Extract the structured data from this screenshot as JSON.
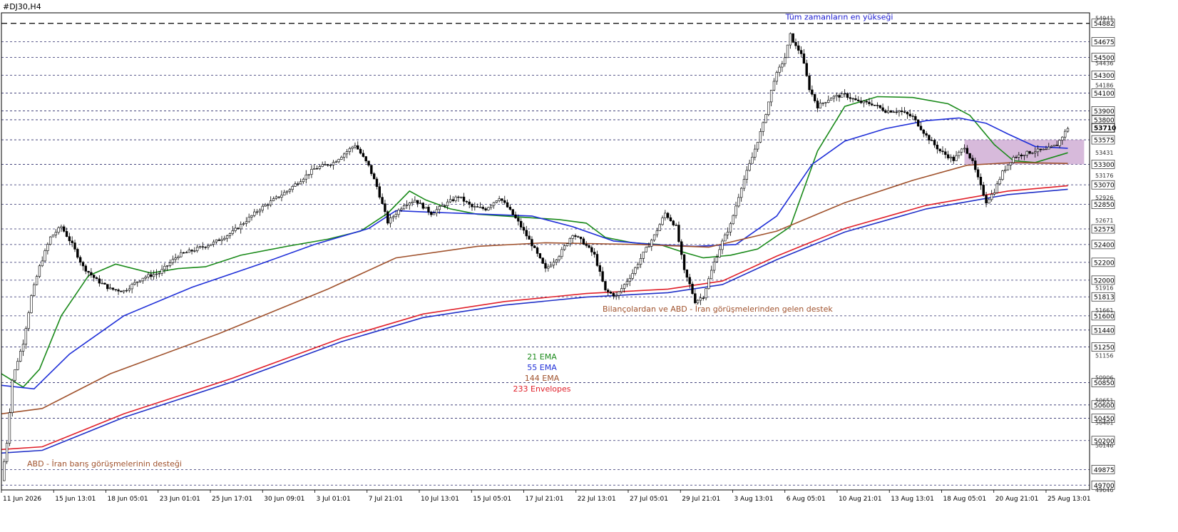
{
  "window": {
    "symbol_title": "#DJ30,H4"
  },
  "colors": {
    "background": "#ffffff",
    "candle": "#000000",
    "ema21": "#1a8a1a",
    "ema55": "#1f2fd8",
    "ema144": "#a0522d",
    "envelope_upper": "#e0202a",
    "envelope_lower": "#2030c8",
    "level_line": "#2a2a6a",
    "ath_line": "#000000",
    "zone_fill": "#c9a3cf",
    "ath_label": "#1a1ad0",
    "note_label": "#a0522d"
  },
  "chart_data": {
    "type": "candlestick",
    "symbol": "#DJ30",
    "timeframe": "H4",
    "price_range": [
      49646,
      55000
    ],
    "x_labels": [
      "11 Jun 2026",
      "15 Jun 13:01",
      "18 Jun 05:01",
      "23 Jun 01:01",
      "25 Jun 17:01",
      "30 Jun 09:01",
      "3 Jul 01:01",
      "7 Jul 21:01",
      "10 Jul 13:01",
      "15 Jul 05:01",
      "17 Jul 21:01",
      "22 Jul 13:01",
      "27 Jul 05:01",
      "29 Jul 21:01",
      "3 Aug 13:01",
      "6 Aug 05:01",
      "10 Aug 21:01",
      "13 Aug 13:01",
      "18 Aug 05:01",
      "20 Aug 21:01",
      "25 Aug 13:01"
    ],
    "level_labels": [
      54882,
      54675,
      54500,
      54300,
      54100,
      53900,
      53800,
      53575,
      53300,
      53070,
      52850,
      52575,
      52400,
      52200,
      52000,
      51813,
      51600,
      51440,
      51250,
      50850,
      50600,
      50450,
      50200,
      49875,
      49700
    ],
    "minor_ticks": [
      54941,
      54436,
      54186,
      53431,
      53176,
      52926,
      52671,
      51916,
      51661,
      51156,
      50906,
      50651,
      50401,
      50146,
      49646
    ],
    "current_price": 53710,
    "ath_label": "Tüm zamanların en yükseği",
    "support_zone": {
      "from": 53300,
      "to": 53575,
      "label": ""
    },
    "series": [
      {
        "name": "21 EMA",
        "key": "ema21",
        "points": [
          [
            0,
            50950
          ],
          [
            8,
            50800
          ],
          [
            14,
            51000
          ],
          [
            22,
            51600
          ],
          [
            32,
            52050
          ],
          [
            42,
            52180
          ],
          [
            55,
            52080
          ],
          [
            65,
            52130
          ],
          [
            75,
            52150
          ],
          [
            88,
            52280
          ],
          [
            105,
            52380
          ],
          [
            120,
            52460
          ],
          [
            132,
            52550
          ],
          [
            142,
            52750
          ],
          [
            150,
            53000
          ],
          [
            156,
            52900
          ],
          [
            165,
            52800
          ],
          [
            175,
            52740
          ],
          [
            185,
            52720
          ],
          [
            195,
            52700
          ],
          [
            205,
            52680
          ],
          [
            215,
            52640
          ],
          [
            222,
            52480
          ],
          [
            232,
            52420
          ],
          [
            242,
            52400
          ],
          [
            250,
            52320
          ],
          [
            258,
            52250
          ],
          [
            268,
            52280
          ],
          [
            278,
            52350
          ],
          [
            290,
            52600
          ],
          [
            300,
            53450
          ],
          [
            310,
            53950
          ],
          [
            322,
            54060
          ],
          [
            335,
            54050
          ],
          [
            348,
            53980
          ],
          [
            356,
            53850
          ],
          [
            365,
            53520
          ],
          [
            372,
            53340
          ],
          [
            380,
            53320
          ],
          [
            392,
            53430
          ]
        ]
      },
      {
        "name": "55 EMA",
        "key": "ema55",
        "points": [
          [
            0,
            50820
          ],
          [
            12,
            50780
          ],
          [
            25,
            51170
          ],
          [
            45,
            51600
          ],
          [
            70,
            51920
          ],
          [
            95,
            52180
          ],
          [
            115,
            52400
          ],
          [
            135,
            52580
          ],
          [
            145,
            52780
          ],
          [
            160,
            52760
          ],
          [
            178,
            52740
          ],
          [
            195,
            52720
          ],
          [
            210,
            52600
          ],
          [
            225,
            52440
          ],
          [
            240,
            52400
          ],
          [
            255,
            52380
          ],
          [
            270,
            52400
          ],
          [
            285,
            52720
          ],
          [
            298,
            53300
          ],
          [
            310,
            53560
          ],
          [
            325,
            53700
          ],
          [
            340,
            53790
          ],
          [
            352,
            53820
          ],
          [
            362,
            53760
          ],
          [
            370,
            53640
          ],
          [
            380,
            53500
          ],
          [
            392,
            53480
          ]
        ]
      },
      {
        "name": "144 EMA",
        "key": "ema144",
        "points": [
          [
            0,
            50500
          ],
          [
            15,
            50560
          ],
          [
            40,
            50950
          ],
          [
            80,
            51400
          ],
          [
            120,
            51900
          ],
          [
            145,
            52250
          ],
          [
            175,
            52380
          ],
          [
            200,
            52420
          ],
          [
            235,
            52400
          ],
          [
            260,
            52370
          ],
          [
            285,
            52550
          ],
          [
            310,
            52870
          ],
          [
            335,
            53120
          ],
          [
            355,
            53290
          ],
          [
            372,
            53320
          ],
          [
            392,
            53310
          ]
        ]
      },
      {
        "name": "233 Envelopes",
        "key": "envelope_upper",
        "points": [
          [
            0,
            50100
          ],
          [
            15,
            50130
          ],
          [
            45,
            50500
          ],
          [
            85,
            50900
          ],
          [
            125,
            51350
          ],
          [
            155,
            51620
          ],
          [
            185,
            51760
          ],
          [
            215,
            51850
          ],
          [
            245,
            51900
          ],
          [
            265,
            51990
          ],
          [
            285,
            52270
          ],
          [
            310,
            52580
          ],
          [
            340,
            52840
          ],
          [
            370,
            53000
          ],
          [
            392,
            53060
          ]
        ]
      },
      {
        "name": "",
        "key": "envelope_lower",
        "points": [
          [
            0,
            50060
          ],
          [
            15,
            50090
          ],
          [
            45,
            50460
          ],
          [
            85,
            50860
          ],
          [
            125,
            51310
          ],
          [
            155,
            51580
          ],
          [
            185,
            51720
          ],
          [
            215,
            51810
          ],
          [
            245,
            51860
          ],
          [
            265,
            51950
          ],
          [
            285,
            52230
          ],
          [
            310,
            52540
          ],
          [
            340,
            52800
          ],
          [
            370,
            52960
          ],
          [
            392,
            53020
          ]
        ]
      }
    ],
    "price_path": [
      [
        0,
        49750
      ],
      [
        2,
        50180
      ],
      [
        4,
        50880
      ],
      [
        6,
        51100
      ],
      [
        8,
        51300
      ],
      [
        11,
        51820
      ],
      [
        14,
        52150
      ],
      [
        18,
        52480
      ],
      [
        22,
        52600
      ],
      [
        26,
        52400
      ],
      [
        30,
        52150
      ],
      [
        35,
        52000
      ],
      [
        40,
        51900
      ],
      [
        45,
        51880
      ],
      [
        52,
        52030
      ],
      [
        58,
        52080
      ],
      [
        65,
        52280
      ],
      [
        70,
        52330
      ],
      [
        78,
        52420
      ],
      [
        85,
        52540
      ],
      [
        95,
        52800
      ],
      [
        105,
        53000
      ],
      [
        115,
        53250
      ],
      [
        122,
        53320
      ],
      [
        130,
        53520
      ],
      [
        135,
        53280
      ],
      [
        138,
        53050
      ],
      [
        142,
        52650
      ],
      [
        148,
        52850
      ],
      [
        152,
        52900
      ],
      [
        158,
        52750
      ],
      [
        163,
        52850
      ],
      [
        168,
        52940
      ],
      [
        173,
        52820
      ],
      [
        178,
        52800
      ],
      [
        183,
        52930
      ],
      [
        186,
        52820
      ],
      [
        190,
        52650
      ],
      [
        195,
        52400
      ],
      [
        200,
        52120
      ],
      [
        205,
        52280
      ],
      [
        210,
        52520
      ],
      [
        214,
        52420
      ],
      [
        218,
        52280
      ],
      [
        222,
        51880
      ],
      [
        226,
        51820
      ],
      [
        232,
        52080
      ],
      [
        236,
        52300
      ],
      [
        240,
        52500
      ],
      [
        244,
        52750
      ],
      [
        248,
        52600
      ],
      [
        251,
        52100
      ],
      [
        253,
        51950
      ],
      [
        255,
        51760
      ],
      [
        258,
        51820
      ],
      [
        262,
        52200
      ],
      [
        265,
        52430
      ],
      [
        268,
        52620
      ],
      [
        272,
        53050
      ],
      [
        276,
        53380
      ],
      [
        280,
        53750
      ],
      [
        284,
        54250
      ],
      [
        288,
        54500
      ],
      [
        290,
        54750
      ],
      [
        292,
        54620
      ],
      [
        294,
        54550
      ],
      [
        297,
        54150
      ],
      [
        300,
        53950
      ],
      [
        305,
        54050
      ],
      [
        310,
        54080
      ],
      [
        315,
        54000
      ],
      [
        320,
        53980
      ],
      [
        325,
        53900
      ],
      [
        330,
        53900
      ],
      [
        335,
        53830
      ],
      [
        340,
        53620
      ],
      [
        345,
        53450
      ],
      [
        350,
        53350
      ],
      [
        354,
        53500
      ],
      [
        357,
        53320
      ],
      [
        360,
        53050
      ],
      [
        362,
        52880
      ],
      [
        365,
        53000
      ],
      [
        368,
        53210
      ],
      [
        372,
        53380
      ],
      [
        376,
        53420
      ],
      [
        380,
        53450
      ],
      [
        384,
        53460
      ],
      [
        388,
        53520
      ],
      [
        392,
        53710
      ]
    ],
    "annotations": [
      "Bilançolardan ve ABD - İran görüşmelerinden gelen destek",
      "ABD - İran barış görüşmelerinin desteği"
    ],
    "legend": [
      "21 EMA",
      "55 EMA",
      "144 EMA",
      "233 Envelopes"
    ]
  }
}
